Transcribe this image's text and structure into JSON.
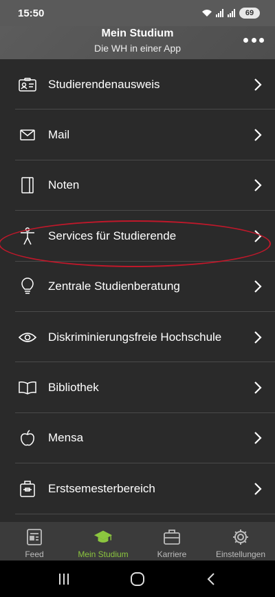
{
  "status_bar": {
    "time": "15:50",
    "battery": "69",
    "icons": [
      "wifi-icon",
      "signal-icon",
      "signal-icon",
      "battery-icon"
    ]
  },
  "header": {
    "title": "Mein Studium",
    "subtitle": "Die WH in einer App",
    "more_icon": "more-horizontal-icon"
  },
  "menu": {
    "items": [
      {
        "label": "Studierendenausweis",
        "icon": "id-card-icon"
      },
      {
        "label": "Mail",
        "icon": "mail-icon"
      },
      {
        "label": "Noten",
        "icon": "notebook-icon"
      },
      {
        "label": "Services für Studierende",
        "icon": "person-icon"
      },
      {
        "label": "Zentrale Studienberatung",
        "icon": "lightbulb-icon"
      },
      {
        "label": "Diskriminierungsfreie Hochschule",
        "icon": "eye-icon"
      },
      {
        "label": "Bibliothek",
        "icon": "book-icon"
      },
      {
        "label": "Mensa",
        "icon": "apple-icon"
      },
      {
        "label": "Erstsemesterbereich",
        "icon": "bag-icon"
      }
    ]
  },
  "tabs": [
    {
      "label": "Feed",
      "icon": "feed-icon",
      "active": false
    },
    {
      "label": "Mein Studium",
      "icon": "graduation-cap-icon",
      "active": true
    },
    {
      "label": "Karriere",
      "icon": "briefcase-icon",
      "active": false
    },
    {
      "label": "Einstellungen",
      "icon": "gear-icon",
      "active": false
    }
  ],
  "colors": {
    "accent_green": "#8cc63f",
    "highlight_red": "#c0182a",
    "list_background": "#2a2a2a",
    "header_background": "#555555"
  },
  "system_nav": [
    "recent-apps-icon",
    "home-icon",
    "back-icon"
  ]
}
